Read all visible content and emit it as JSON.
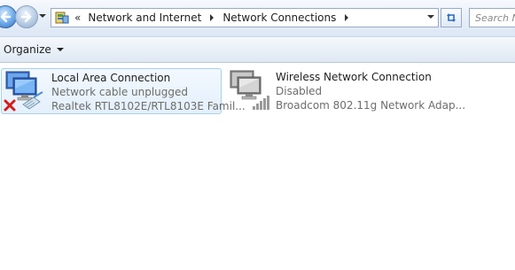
{
  "address_bar": {
    "crumbs": [
      "Network and Internet",
      "Network Connections"
    ],
    "overflow_glyph": "«"
  },
  "search": {
    "placeholder": "Search N"
  },
  "toolbar": {
    "organize_label": "Organize"
  },
  "connections": [
    {
      "name": "Local Area Connection",
      "status": "Network cable unplugged",
      "adapter": "Realtek RTL8102E/RTL8103E Famil...",
      "icon": "wired-network-disconnected-icon",
      "selected": true
    },
    {
      "name": "Wireless Network Connection",
      "status": "Disabled",
      "adapter": "Broadcom 802.11g Network Adap...",
      "icon": "wireless-network-disabled-icon",
      "selected": false
    }
  ],
  "colors": {
    "selection_border": "#a8d0f0",
    "status_text": "#6d6d6d",
    "error_x": "#d61a1a"
  }
}
